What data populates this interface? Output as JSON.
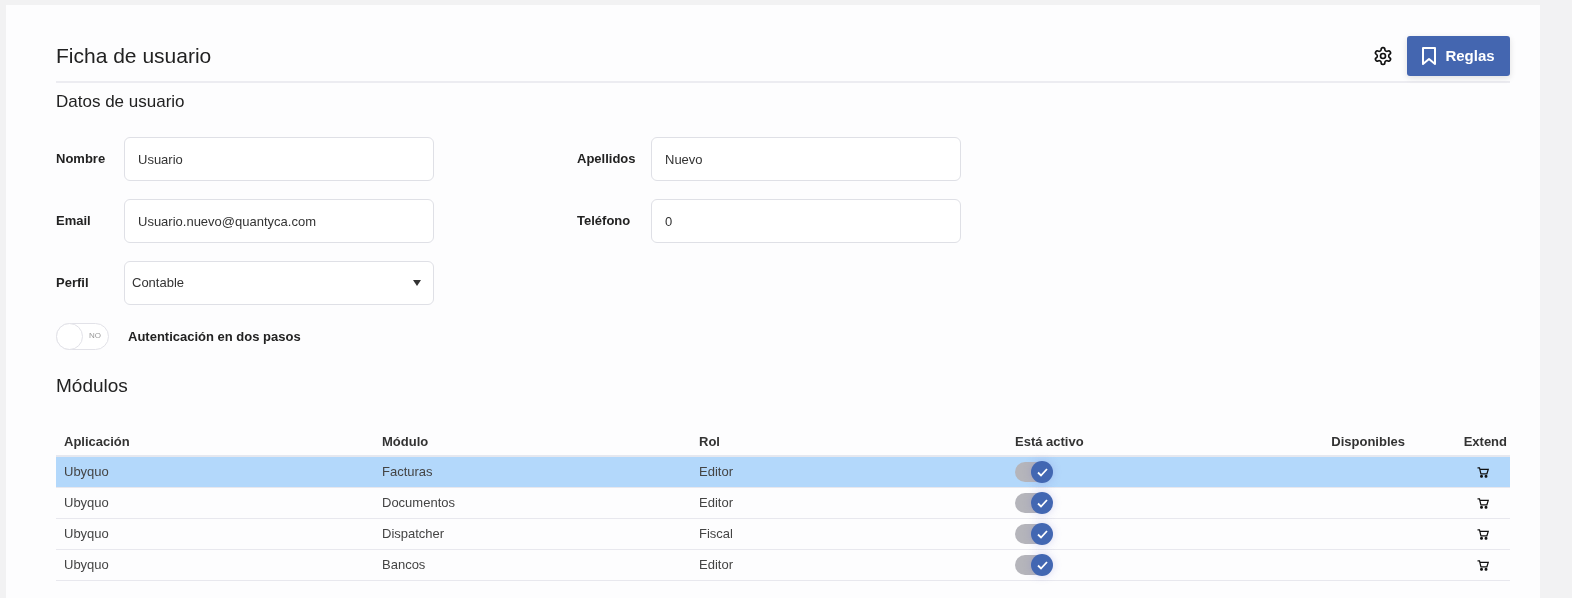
{
  "header": {
    "title": "Ficha de usuario",
    "rules_button": "Reglas"
  },
  "section_title": "Datos de usuario",
  "fields": [
    {
      "label": "Nombre",
      "value": "Usuario",
      "kind": "text"
    },
    {
      "label": "Apellidos",
      "value": "Nuevo",
      "kind": "text"
    },
    {
      "label": "Email",
      "value": "Usuario.nuevo@quantyca.com",
      "kind": "text"
    },
    {
      "label": "Teléfono",
      "value": "0",
      "kind": "text"
    },
    {
      "label": "Perfil",
      "value": "Contable",
      "kind": "select"
    }
  ],
  "two_factor": {
    "label": "Autenticación en dos pasos",
    "on": false,
    "state_text": "NO"
  },
  "modules": {
    "title": "Módulos",
    "columns": [
      "Aplicación",
      "Módulo",
      "Rol",
      "Está activo",
      "Disponibles",
      "Extend"
    ],
    "rows": [
      {
        "application": "Ubyquo",
        "module": "Facturas",
        "role": "Editor",
        "active": true,
        "selected": true
      },
      {
        "application": "Ubyquo",
        "module": "Documentos",
        "role": "Editor",
        "active": true,
        "selected": false
      },
      {
        "application": "Ubyquo",
        "module": "Dispatcher",
        "role": "Fiscal",
        "active": true,
        "selected": false
      },
      {
        "application": "Ubyquo",
        "module": "Bancos",
        "role": "Editor",
        "active": true,
        "selected": false
      }
    ]
  }
}
